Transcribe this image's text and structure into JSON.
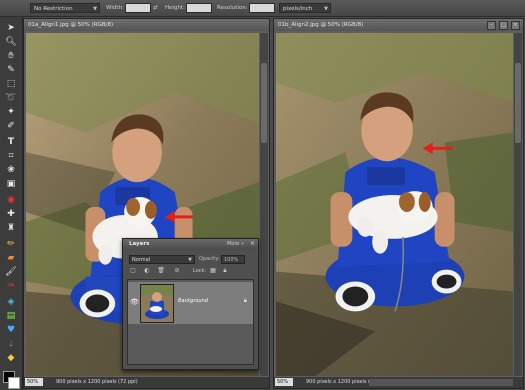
{
  "options_bar": {
    "restriction_value": "No Restriction",
    "width_label": "Width:",
    "height_label": "Height:",
    "resolution_label": "Resolution:",
    "resolution_unit": "pixels/inch"
  },
  "toolbox": {
    "tools": [
      "move-icon",
      "zoom-icon",
      "hand-icon",
      "eyedropper-icon",
      "marquee-icon",
      "lasso-icon",
      "magic-wand-icon",
      "selection-brush-icon",
      "type-icon",
      "crop-icon",
      "cookie-cutter-icon",
      "straighten-icon",
      "red-eye-icon",
      "healing-brush-icon",
      "clone-stamp-icon",
      "eraser-icon",
      "pencil-icon",
      "brush-icon",
      "smart-brush-icon",
      "paint-bucket-icon",
      "gradient-icon",
      "shape-icon",
      "blur-icon",
      "sponge-icon",
      "color-swatch-icon"
    ]
  },
  "doc_left": {
    "title": "01a_Align1.jpg @ 50% (RGB/8)",
    "zoom": "50%",
    "info": "900 pixels x 1200 pixels (72 ppi)"
  },
  "doc_right": {
    "title": "01b_Align2.jpg @ 50% (RGB/8)",
    "zoom": "50%",
    "info": "900 pixels x 1200 pixels (72 ppi)"
  },
  "layers_panel": {
    "title": "Layers",
    "more_label": "More »",
    "blend_mode": "Normal",
    "opacity_label": "Opacity:",
    "opacity_value": "100%",
    "lock_label": "Lock:",
    "layer_name": "Background"
  },
  "colors": {
    "annotation_arrow": "#e0201a",
    "shirt_blue": "#1d3fb0"
  }
}
